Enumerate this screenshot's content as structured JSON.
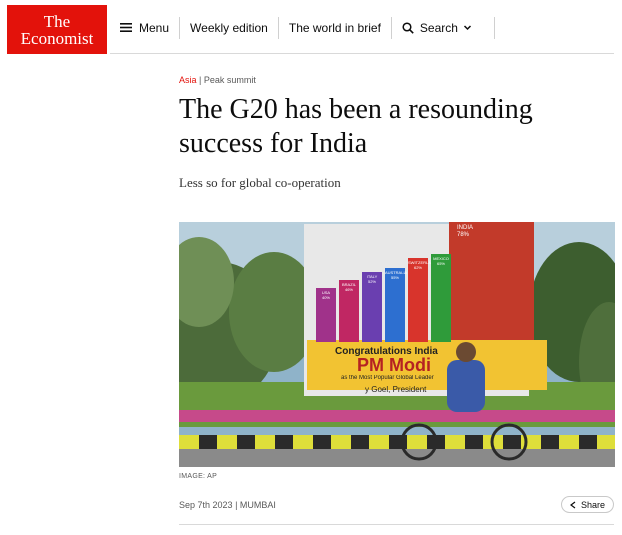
{
  "brand": {
    "line1": "The",
    "line2": "Economist",
    "color": "#e3120b"
  },
  "nav": {
    "menu_label": "Menu",
    "weekly_label": "Weekly edition",
    "brief_label": "The world in brief",
    "search_label": "Search"
  },
  "article": {
    "section": "Asia",
    "rubric": "Peak summit",
    "headline": "The G20 has been a resounding success for India",
    "subheadline": "Less so for global co-operation",
    "image_credit": "IMAGE: AP",
    "date": "Sep 7th 2023",
    "location": "MUMBAI",
    "share_label": "Share"
  },
  "billboard": {
    "india_label": "INDIA",
    "india_pct": "78%",
    "congrats": "Congratulations India",
    "pm": "PM Modi",
    "tagline": "as the Most Popular Global Leader",
    "signed": "y Goel, President",
    "bars": [
      {
        "label": "USA",
        "pct": "40%",
        "color": "#a0328a"
      },
      {
        "label": "BRAZIL",
        "pct": "46%",
        "color": "#c02763"
      },
      {
        "label": "ITALY",
        "pct": "52%",
        "color": "#6a3fb0"
      },
      {
        "label": "AUSTRALIA",
        "pct": "55%",
        "color": "#2d6fd0"
      },
      {
        "label": "SWITZERLAND",
        "pct": "62%",
        "color": "#d8342c"
      },
      {
        "label": "MEXICO",
        "pct": "65%",
        "color": "#2f9b3a"
      }
    ]
  }
}
